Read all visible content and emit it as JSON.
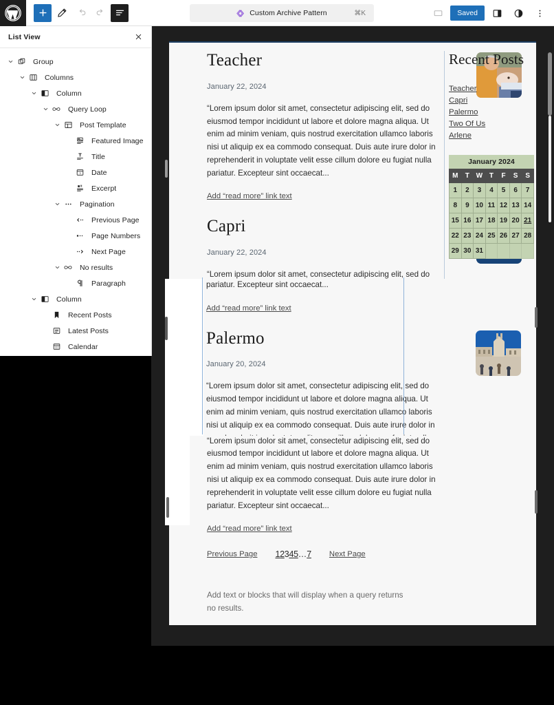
{
  "app": {
    "logo_icon": "wordpress-logo"
  },
  "toolbar": {
    "add_block_label": "+",
    "add_block_name": "plus-icon",
    "tools_name": "pencil-icon",
    "undo_name": "undo-arrow-icon",
    "redo_name": "redo-arrow-icon",
    "listview_name": "list-view-icon",
    "document_title": "Custom Archive Pattern",
    "document_icon": "pattern-diamond-icon",
    "shortcut": "⌘K",
    "preview_name": "preview-desktop-icon",
    "save_label": "Saved",
    "settings_name": "settings-sidebar-icon",
    "styles_name": "styles-contrast-icon",
    "options_name": "more-options-icon"
  },
  "list_view": {
    "title": "List View",
    "close_label": "×",
    "items": [
      {
        "label": "Group",
        "depth": 0,
        "icon": "group-icon",
        "expandable": true
      },
      {
        "label": "Columns",
        "depth": 1,
        "icon": "columns-icon",
        "expandable": true
      },
      {
        "label": "Column",
        "depth": 2,
        "icon": "column-icon",
        "expandable": true
      },
      {
        "label": "Query Loop",
        "depth": 3,
        "icon": "loop-icon",
        "expandable": true
      },
      {
        "label": "Post Template",
        "depth": 4,
        "icon": "post-template-icon",
        "expandable": true
      },
      {
        "label": "Featured Image",
        "depth": 5,
        "icon": "featured-image-icon",
        "expandable": false
      },
      {
        "label": "Title",
        "depth": 5,
        "icon": "title-icon",
        "expandable": false
      },
      {
        "label": "Date",
        "depth": 5,
        "icon": "date-icon",
        "expandable": false
      },
      {
        "label": "Excerpt",
        "depth": 5,
        "icon": "excerpt-icon",
        "expandable": false
      },
      {
        "label": "Pagination",
        "depth": 4,
        "icon": "pagination-icon",
        "expandable": true
      },
      {
        "label": "Previous Page",
        "depth": 5,
        "icon": "previous-page-icon",
        "expandable": false
      },
      {
        "label": "Page Numbers",
        "depth": 5,
        "icon": "page-numbers-icon",
        "expandable": false
      },
      {
        "label": "Next Page",
        "depth": 5,
        "icon": "next-page-icon",
        "expandable": false
      },
      {
        "label": "No results",
        "depth": 4,
        "icon": "no-results-icon",
        "expandable": true
      },
      {
        "label": "Paragraph",
        "depth": 5,
        "icon": "paragraph-icon",
        "expandable": false
      },
      {
        "label": "Column",
        "depth": 2,
        "icon": "column-icon",
        "expandable": true
      },
      {
        "label": "Recent Posts",
        "depth": 3,
        "icon": "recent-posts-icon",
        "expandable": false
      },
      {
        "label": "Latest Posts",
        "depth": 3,
        "icon": "latest-posts-icon",
        "expandable": false
      },
      {
        "label": "Calendar",
        "depth": 3,
        "icon": "calendar-icon",
        "expandable": false
      }
    ]
  },
  "canvas": {
    "excerpt_text": "“Lorem ipsum dolor sit amet, consectetur adipiscing elit, sed do eiusmod tempor incididunt ut labore et dolore magna aliqua. Ut enim ad minim veniam, quis nostrud exercitation ullamco laboris nisi ut aliquip ex ea commodo consequat. Duis aute irure dolor in reprehenderit in voluptate velit esse cillum dolore eu fugiat nulla pariatur. Excepteur sint occaecat...",
    "read_more_label": "Add “read more” link text",
    "posts": [
      {
        "title": "Teacher",
        "date": "January 22, 2024",
        "image": "teacher-photo"
      },
      {
        "title": "Capri",
        "date": "January 22, 2024",
        "image": "capri-photo"
      },
      {
        "title": "Palermo",
        "date": "January 20, 2024",
        "image": "palermo-photo"
      }
    ],
    "pagination": {
      "previous_label": "Previous Page",
      "next_label": "Next Page",
      "numbers": [
        "1",
        "2",
        "3",
        "4",
        "5",
        "…",
        "7"
      ],
      "current": "1"
    },
    "no_results_text": "Add text or blocks that will display when a query returns no results."
  },
  "widgets": {
    "recent_posts": {
      "title": "Recent Posts",
      "items": [
        "Teacher",
        "Capri",
        "Palermo",
        "Two Of Us",
        "Arlene"
      ]
    },
    "calendar": {
      "caption": "January 2024",
      "weekdays": [
        "M",
        "T",
        "W",
        "T",
        "F",
        "S",
        "S"
      ],
      "today": "21",
      "weeks": [
        [
          "1",
          "2",
          "3",
          "4",
          "5",
          "6",
          "7"
        ],
        [
          "8",
          "9",
          "10",
          "11",
          "12",
          "13",
          "14"
        ],
        [
          "15",
          "16",
          "17",
          "18",
          "19",
          "20",
          "21"
        ],
        [
          "22",
          "23",
          "24",
          "25",
          "26",
          "27",
          "28"
        ],
        [
          "29",
          "30",
          "31",
          "",
          "",
          "",
          ""
        ]
      ]
    }
  },
  "colors": {
    "accent_blue": "#1e6fb8",
    "calendar_green": "#c3d3b2",
    "calendar_header": "#4d4d4d",
    "editor_shell": "#1e1e1e",
    "canvas_bg": "#f7f7f7",
    "pattern_purple": "#8c52d9",
    "selection_blue": "#8fb3d9"
  }
}
